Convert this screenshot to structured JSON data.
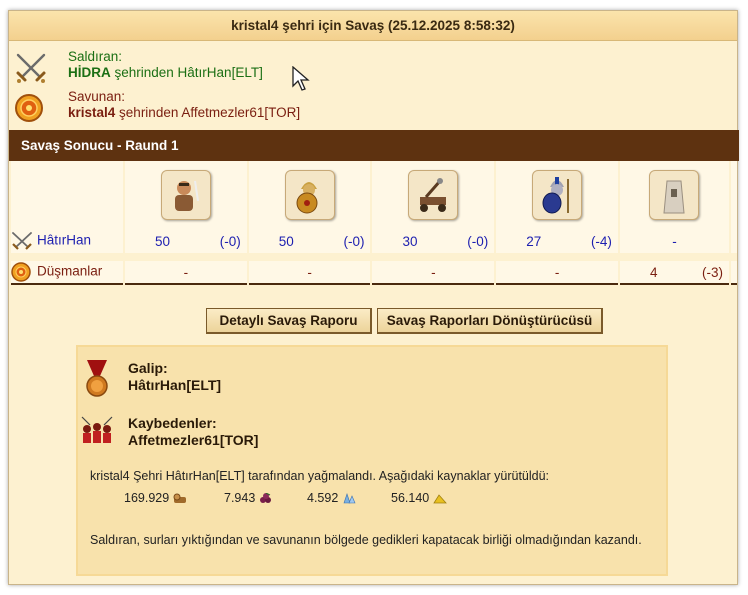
{
  "window": {
    "title": "kristal4 şehri için Savaş (25.12.2025 8:58:32)"
  },
  "attacker": {
    "role": "Saldıran:",
    "city": "HİDRA",
    "city_suffix": " şehrinden ",
    "player": "HâtırHan[ELT]",
    "icon": "crossed-swords-icon"
  },
  "defender": {
    "role": "Savunan:",
    "city": "kristal4",
    "city_suffix": " şehrinden ",
    "player": "Affetmezler61[TOR]",
    "icon": "shield-icon"
  },
  "result": {
    "header": "Savaş Sonucu - Raund 1",
    "unit_icons": [
      "slinger-unit-icon",
      "hoplite-unit-icon",
      "catapult-unit-icon",
      "spartan-unit-icon",
      "wall-unit-icon"
    ],
    "rows": [
      {
        "name": "HâtırHan",
        "cells": [
          {
            "count": "50",
            "loss": "(-0)"
          },
          {
            "count": "50",
            "loss": "(-0)"
          },
          {
            "count": "30",
            "loss": "(-0)"
          },
          {
            "count": "27",
            "loss": "(-4)"
          },
          {
            "count": "-",
            "loss": ""
          }
        ]
      },
      {
        "name": "Düşmanlar",
        "cells": [
          {
            "count": "-",
            "loss": ""
          },
          {
            "count": "-",
            "loss": ""
          },
          {
            "count": "-",
            "loss": ""
          },
          {
            "count": "-",
            "loss": ""
          },
          {
            "count": "4",
            "loss": "(-3)"
          }
        ]
      }
    ]
  },
  "buttons": {
    "detailed_report": "Detaylı Savaş Raporu",
    "converter": "Savaş Raporları Dönüştürücüsü"
  },
  "summary": {
    "winner_label": "Galip:",
    "winner": "HâtırHan[ELT]",
    "losers_label": "Kaybedenler:",
    "losers": "Affetmezler61[TOR]",
    "plunder_text": "kristal4 Şehri HâtırHan[ELT] tarafından yağmalandı. Aşağıdaki kaynaklar yürütüldü:",
    "resources": [
      {
        "amount": "169.929",
        "icon": "wood-icon"
      },
      {
        "amount": "7.943",
        "icon": "wine-icon"
      },
      {
        "amount": "4.592",
        "icon": "crystal-icon"
      },
      {
        "amount": "56.140",
        "icon": "sulfur-icon"
      }
    ],
    "explanation": "Saldıran, surları yıktığından ve savunanın bölgede gedikleri kapatacak birliği olmadığından kazandı."
  }
}
